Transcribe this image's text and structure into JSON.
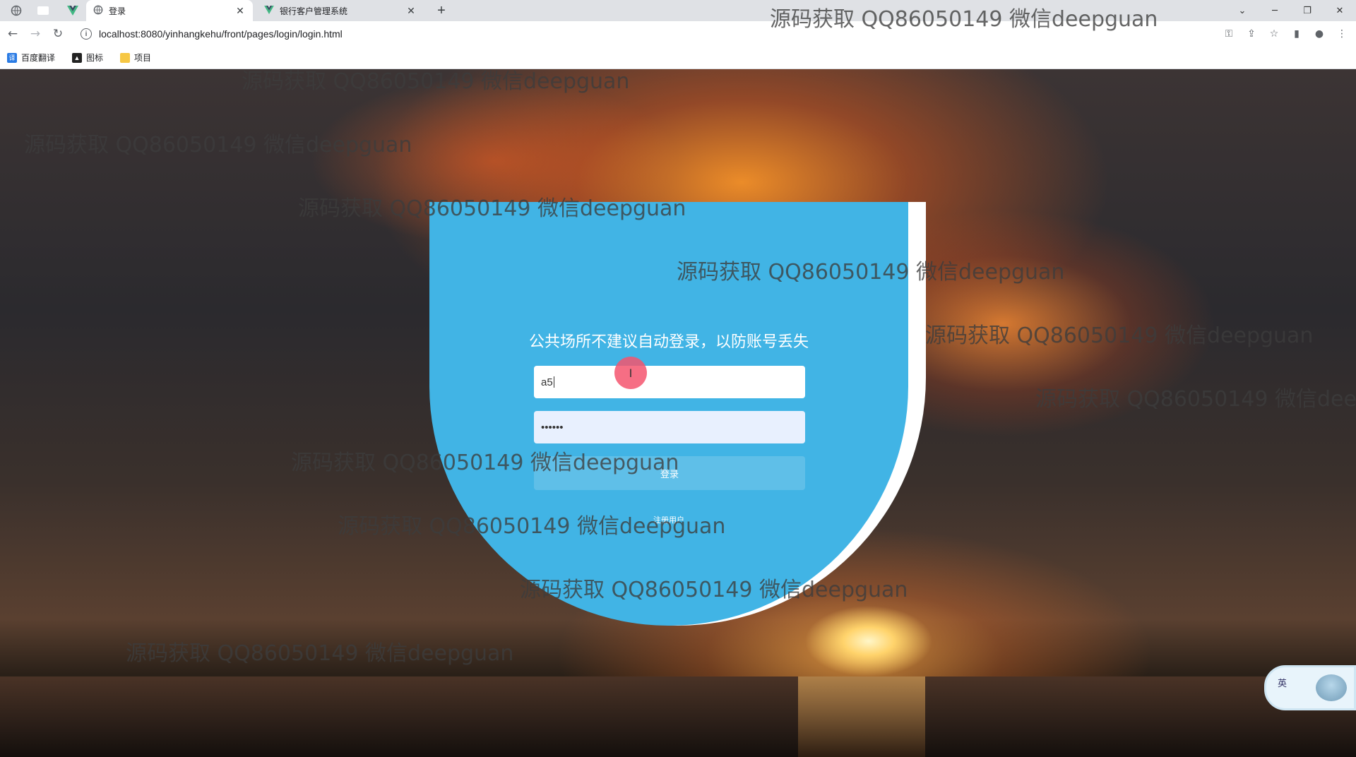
{
  "browser": {
    "tabs": [
      {
        "title": "登录",
        "active": true
      },
      {
        "title": "银行客户管理系统",
        "active": false
      }
    ],
    "new_tab_symbol": "+",
    "url": "localhost:8080/yinhangkehu/front/pages/login/login.html",
    "bookmarks": [
      {
        "label": "百度翻译",
        "icon": "translate-icon"
      },
      {
        "label": "图标",
        "icon": "image-icon"
      },
      {
        "label": "项目",
        "icon": "folder-icon"
      }
    ]
  },
  "login": {
    "notice": "公共场所不建议自动登录，以防账号丢失",
    "username_value": "a5",
    "password_value": "••••••",
    "login_button": "登录",
    "register_link": "注册用户"
  },
  "watermark": "源码获取 QQ86050149 微信deepguan",
  "ime": {
    "label": "英"
  },
  "colors": {
    "card": "#41b4e5",
    "card_edge": "#ffffff",
    "cursor_highlight": "#f5556e"
  }
}
